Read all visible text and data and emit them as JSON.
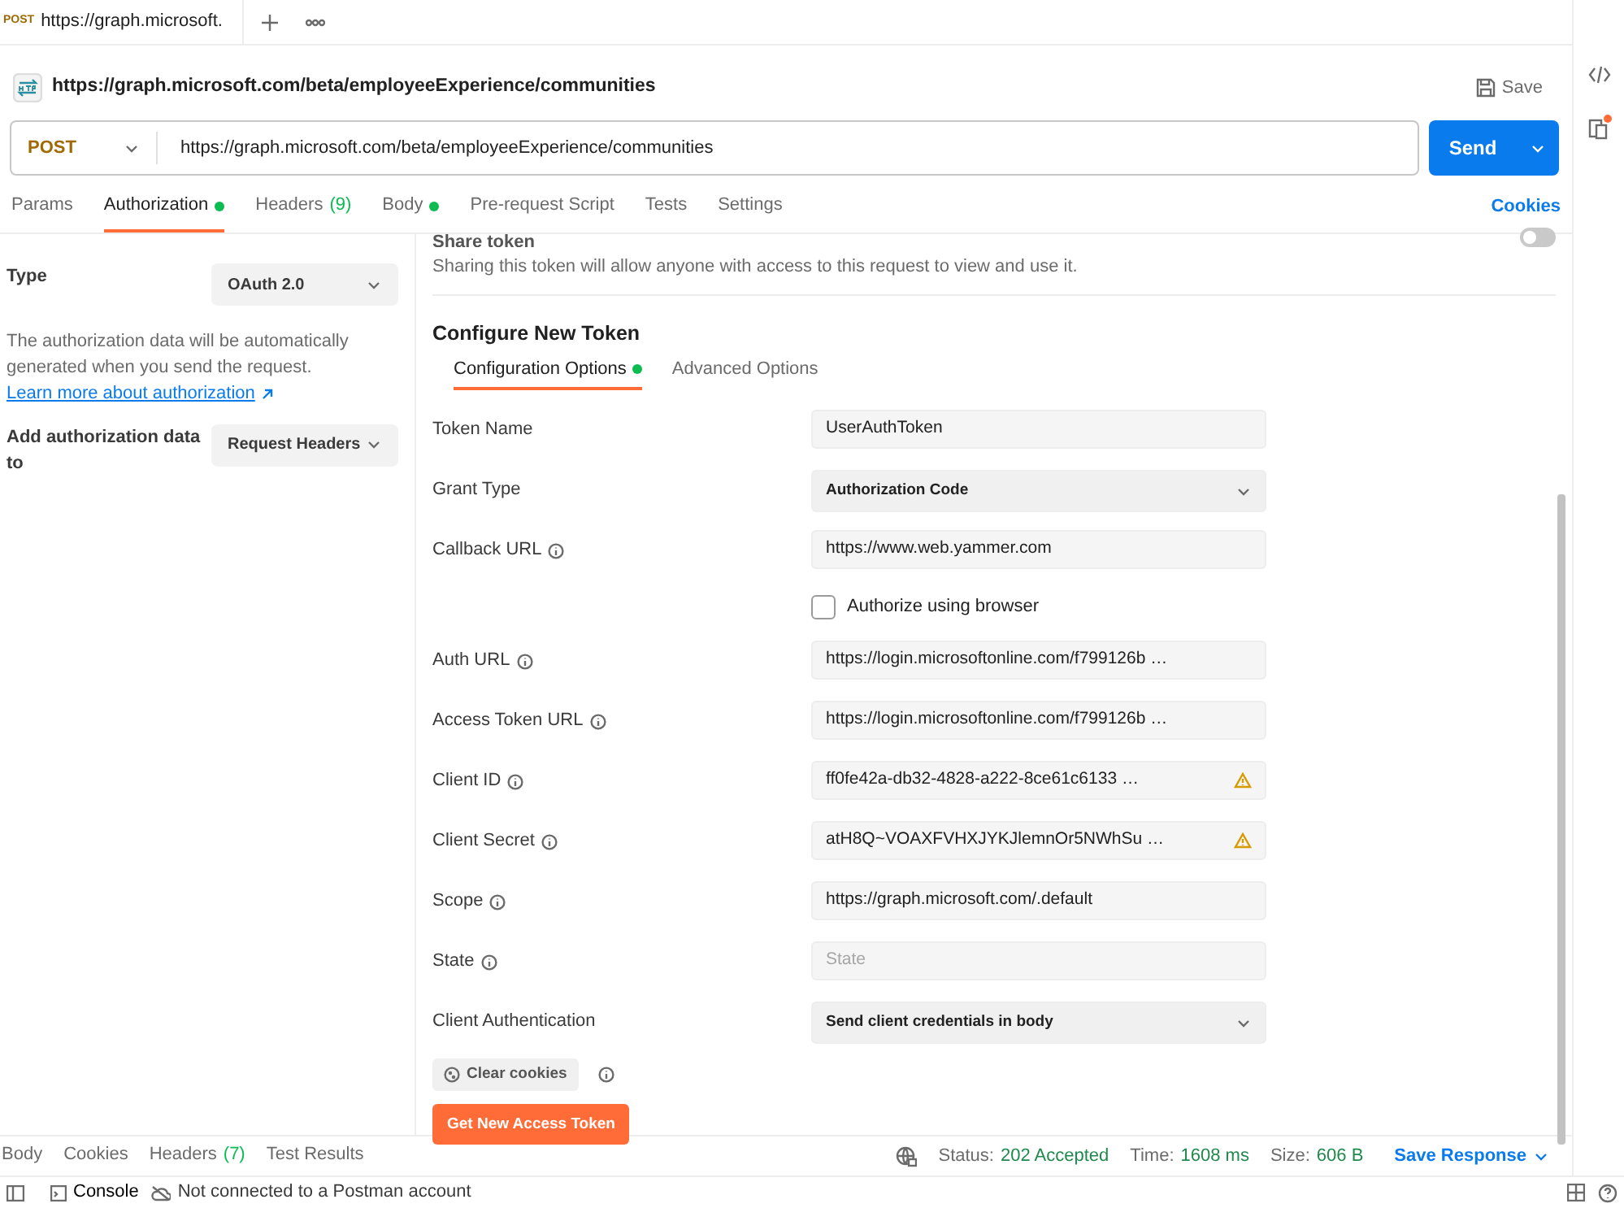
{
  "tab": {
    "method": "POST",
    "title": "https://graph.microsoft."
  },
  "request": {
    "title": "https://graph.microsoft.com/beta/employeeExperience/communities",
    "save": "Save",
    "method": "POST",
    "url": "https://graph.microsoft.com/beta/employeeExperience/communities",
    "send": "Send"
  },
  "request_tabs": [
    {
      "label": "Params",
      "selected": false,
      "dot": false
    },
    {
      "label": "Authorization",
      "selected": true,
      "dot": true
    },
    {
      "label": "Headers",
      "count": "(9)",
      "selected": false,
      "dot": false
    },
    {
      "label": "Body",
      "selected": false,
      "dot": true
    },
    {
      "label": "Pre-request Script",
      "selected": false,
      "dot": false
    },
    {
      "label": "Tests",
      "selected": false,
      "dot": false
    },
    {
      "label": "Settings",
      "selected": false,
      "dot": false
    }
  ],
  "cookies_link": "Cookies",
  "auth": {
    "type_label": "Type",
    "type_value": "OAuth 2.0",
    "description": "The authorization data will be automatically generated when you send the request.",
    "learn_more": "Learn more about authorization",
    "add_to_label": "Add authorization data to",
    "add_to_value": "Request Headers"
  },
  "share": {
    "title": "Share token",
    "description": "Sharing this token will allow anyone with access to this request to view and use it.",
    "on": false
  },
  "configure": {
    "title": "Configure New Token",
    "tabs": [
      {
        "label": "Configuration Options",
        "selected": true,
        "dot": true
      },
      {
        "label": "Advanced Options",
        "selected": false,
        "dot": false
      }
    ],
    "fields": [
      {
        "kind": "input",
        "label": "Token Name",
        "info": false,
        "value": "UserAuthToken",
        "warning": false
      },
      {
        "kind": "select",
        "label": "Grant Type",
        "info": false,
        "value": "Authorization Code"
      },
      {
        "kind": "input",
        "label": "Callback URL",
        "info": true,
        "value": "https://www.web.yammer.com",
        "warning": false
      },
      {
        "kind": "checkbox",
        "label": "Authorize using browser",
        "checked": false
      },
      {
        "kind": "input",
        "label": "Auth URL",
        "info": true,
        "value": "https://login.microsoftonline.com/f799126b …",
        "warning": false
      },
      {
        "kind": "input",
        "label": "Access Token URL",
        "info": true,
        "value": "https://login.microsoftonline.com/f799126b …",
        "warning": false
      },
      {
        "kind": "input",
        "label": "Client ID",
        "info": true,
        "value": "ff0fe42a-db32-4828-a222-8ce61c6133 …",
        "warning": true
      },
      {
        "kind": "input",
        "label": "Client Secret",
        "info": true,
        "value": "atH8Q~VOAXFVHXJYKJlemnOr5NWhSu …",
        "warning": true
      },
      {
        "kind": "input",
        "label": "Scope",
        "info": true,
        "value": "https://graph.microsoft.com/.default",
        "warning": false
      },
      {
        "kind": "input",
        "label": "State",
        "info": true,
        "placeholder": "State",
        "warning": false
      },
      {
        "kind": "select",
        "label": "Client Authentication",
        "info": false,
        "value": "Send client credentials in body"
      }
    ],
    "clear_cookies": "Clear cookies",
    "get_token": "Get New Access Token"
  },
  "response": {
    "tabs": [
      {
        "label": "Body"
      },
      {
        "label": "Cookies"
      },
      {
        "label": "Headers",
        "count": "(7)"
      },
      {
        "label": "Test Results"
      }
    ],
    "status_label": "Status:",
    "status": "202 Accepted",
    "time_label": "Time:",
    "time": "1608 ms",
    "size_label": "Size:",
    "size": "606 B",
    "save": "Save Response"
  },
  "status_bar": {
    "console": "Console",
    "connection": "Not connected to a Postman account"
  }
}
